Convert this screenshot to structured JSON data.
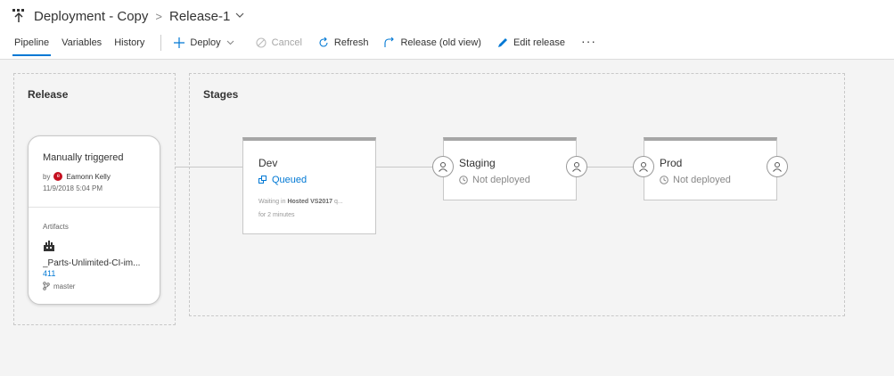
{
  "header": {
    "pipeline_name": "Deployment - Copy",
    "separator": ">",
    "release_name": "Release-1"
  },
  "tabs": [
    {
      "label": "Pipeline",
      "active": true
    },
    {
      "label": "Variables",
      "active": false
    },
    {
      "label": "History",
      "active": false
    }
  ],
  "toolbar": {
    "deploy": "Deploy",
    "cancel": "Cancel",
    "refresh": "Refresh",
    "release_old_view": "Release (old view)",
    "edit_release": "Edit release",
    "more": "···"
  },
  "release_panel": {
    "title": "Release",
    "trigger": "Manually triggered",
    "by_label": "by",
    "avatar_initial": "e",
    "author": "Eamonn Kelly",
    "date": "11/9/2018 5:04 PM",
    "artifacts_label": "Artifacts",
    "artifact_name": "_Parts-Unlimited-CI-im...",
    "artifact_version": "411",
    "branch": "master"
  },
  "stages_panel": {
    "title": "Stages",
    "stages": [
      {
        "name": "Dev",
        "status": "Queued",
        "waiting_prefix": "Waiting in",
        "waiting_pool": "Hosted VS2017",
        "waiting_suffix": "q...",
        "duration": "for 2 minutes"
      },
      {
        "name": "Staging",
        "status": "Not deployed"
      },
      {
        "name": "Prod",
        "status": "Not deployed"
      }
    ]
  },
  "colors": {
    "accent": "#0078d4",
    "avatar": "#c50f1f",
    "stage_header": "#a6a6a6"
  },
  "icons": [
    "release-pipeline-icon",
    "chevron-down-icon",
    "plus-icon",
    "cancel-icon",
    "refresh-icon",
    "release-old-view-icon",
    "pencil-icon",
    "artifact-build-icon",
    "branch-icon",
    "queued-icon",
    "clock-icon",
    "approver-icon"
  ]
}
